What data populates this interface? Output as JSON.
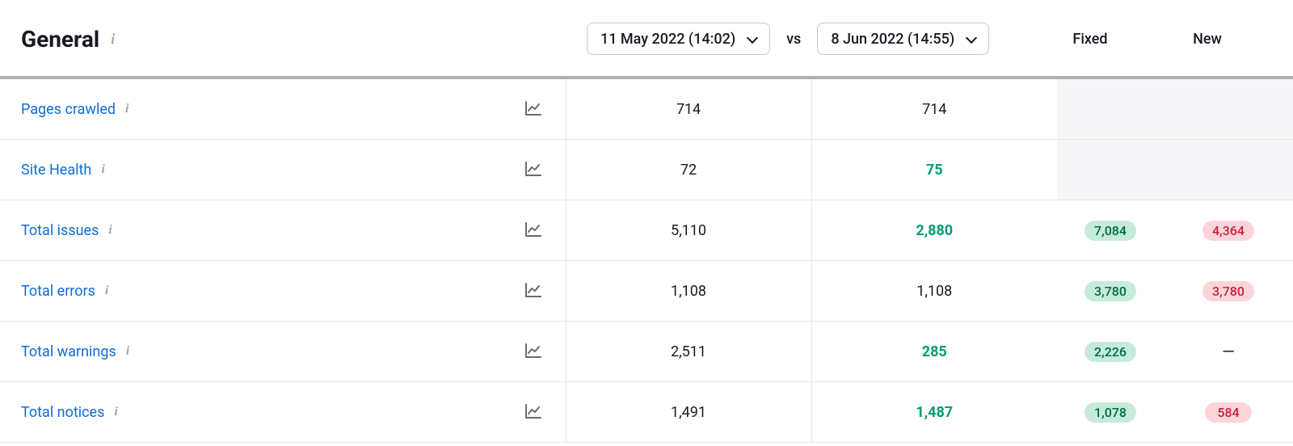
{
  "header": {
    "title": "General",
    "date_from": "11 May 2022 (14:02)",
    "date_to": "8 Jun 2022 (14:55)",
    "vs_label": "vs",
    "fixed_label": "Fixed",
    "new_label": "New"
  },
  "rows": [
    {
      "label": "Pages crawled",
      "v1": "714",
      "v2": "714",
      "v2_green": false,
      "fixed": "",
      "new": "",
      "shaded_tail": true
    },
    {
      "label": "Site Health",
      "v1": "72",
      "v2": "75",
      "v2_green": true,
      "fixed": "",
      "new": "",
      "shaded_tail": true
    },
    {
      "label": "Total issues",
      "v1": "5,110",
      "v2": "2,880",
      "v2_green": true,
      "fixed": "7,084",
      "new": "4,364",
      "shaded_tail": false
    },
    {
      "label": "Total errors",
      "v1": "1,108",
      "v2": "1,108",
      "v2_green": false,
      "fixed": "3,780",
      "new": "3,780",
      "shaded_tail": false
    },
    {
      "label": "Total warnings",
      "v1": "2,511",
      "v2": "285",
      "v2_green": true,
      "fixed": "2,226",
      "new": "—",
      "shaded_tail": false
    },
    {
      "label": "Total notices",
      "v1": "1,491",
      "v2": "1,487",
      "v2_green": true,
      "fixed": "1,078",
      "new": "584",
      "shaded_tail": false
    }
  ]
}
